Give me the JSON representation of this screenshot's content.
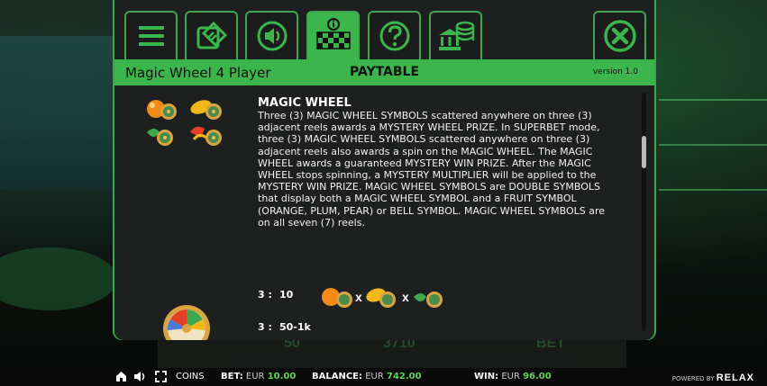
{
  "header": {
    "game_name": "Magic Wheel 4 Player",
    "section_title": "PAYTABLE",
    "version": "version 1.0"
  },
  "tabs": [
    {
      "icon": "menu-icon"
    },
    {
      "icon": "bet-settings-icon"
    },
    {
      "icon": "sound-icon"
    },
    {
      "icon": "paytable-icon",
      "active": true
    },
    {
      "icon": "help-icon"
    },
    {
      "icon": "bank-icon"
    },
    {
      "icon": "close-icon"
    }
  ],
  "symbol": {
    "title": "MAGIC WHEEL",
    "description": "Three (3) MAGIC WHEEL SYMBOLS scattered anywhere on three (3) adjacent reels awards a MYSTERY WHEEL PRIZE. In SUPERBET mode, three (3) MAGIC WHEEL SYMBOLS scattered anywhere on three (3) adjacent reels also awards a spin on the MAGIC WHEEL. The MAGIC WHEEL awards a guaranteed MYSTERY WIN PRIZE. After the MAGIC WHEEL stops spinning, a MYSTERY MULTIPLIER will be applied to the MYSTERY WIN PRIZE. MAGIC WHEEL SYMBOLS are DOUBLE SYMBOLS that display both a MAGIC WHEEL SYMBOL and a FRUIT SYMBOL (ORANGE, PLUM, PEAR) or BELL SYMBOL. MAGIC WHEEL SYMBOLS are on all seven (7) reels.",
    "pays": [
      {
        "count": "3 :",
        "value": "10"
      },
      {
        "count": "3 :",
        "value": "50-1k"
      }
    ],
    "combo_separator": "x"
  },
  "background_console": {
    "bet_value": "50",
    "total_value": "3710",
    "bet_button": "BET"
  },
  "bottom_bar": {
    "coins_label": "COINS",
    "bet_label": "BET:",
    "bet_currency": "EUR",
    "bet_value": "10.00",
    "balance_label": "BALANCE:",
    "balance_currency": "EUR",
    "balance_value": "742.00",
    "win_label": "WIN:",
    "win_currency": "EUR",
    "win_value": "96.00",
    "powered_by": "POWERED BY",
    "brand": "RELAX"
  },
  "colors": {
    "accent": "#3cb64c",
    "panel": "#1e1f1f",
    "value_green": "#5fd45a"
  }
}
